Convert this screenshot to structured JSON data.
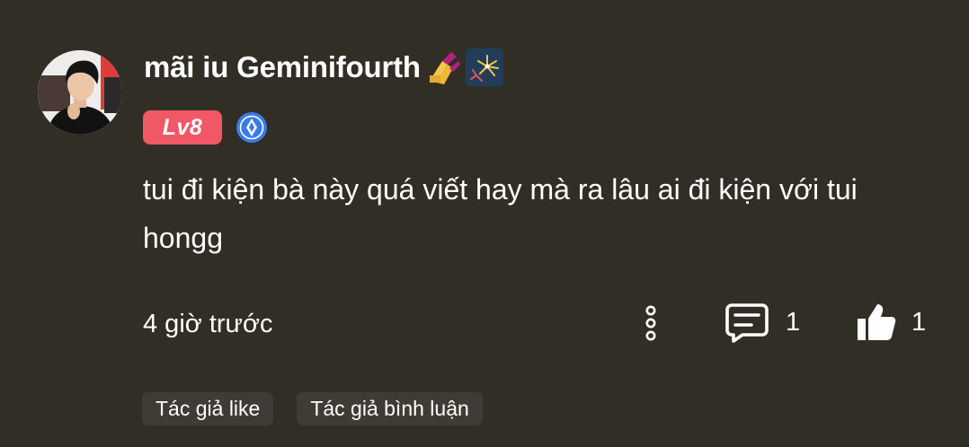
{
  "comment": {
    "username": "mãi iu Geminifourth",
    "username_emojis": [
      "nail-polish-emoji",
      "fireworks-emoji"
    ],
    "level_badge": "Lv8",
    "verified_icon": "blue-diamond-badge-icon",
    "text": "tui đi kiện bà này quá viết hay mà ra lâu ai đi kiện với tui hongg",
    "time": "4 giờ trước",
    "reply_count": "1",
    "like_count": "1",
    "chips": [
      "Tác giả like",
      "Tác giả bình luận"
    ]
  },
  "colors": {
    "background": "#312e26",
    "level_badge": "#f05866",
    "chip_background": "#403c35",
    "verify_badge": "#3b7be8",
    "text": "#ffffff"
  }
}
